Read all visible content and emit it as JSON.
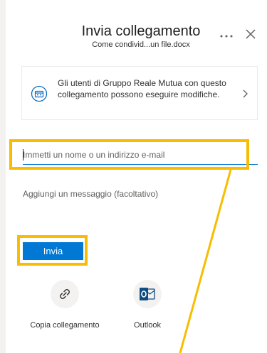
{
  "header": {
    "title": "Invia collegamento",
    "subtitle": "Come condivid...un file.docx"
  },
  "permission": {
    "text": "Gli utenti di Gruppo Reale Mutua con questo collegamento possono eseguire modifiche."
  },
  "form": {
    "email_placeholder": "Immetti un nome o un indirizzo e-mail",
    "message_placeholder": "Aggiungi un messaggio (facoltativo)"
  },
  "send_label": "Invia",
  "actions": [
    {
      "label": "Copia collegamento",
      "icon": "link-icon"
    },
    {
      "label": "Outlook",
      "icon": "outlook-icon"
    }
  ],
  "colors": {
    "accent": "#0078d4",
    "highlight": "#f8bd00"
  }
}
